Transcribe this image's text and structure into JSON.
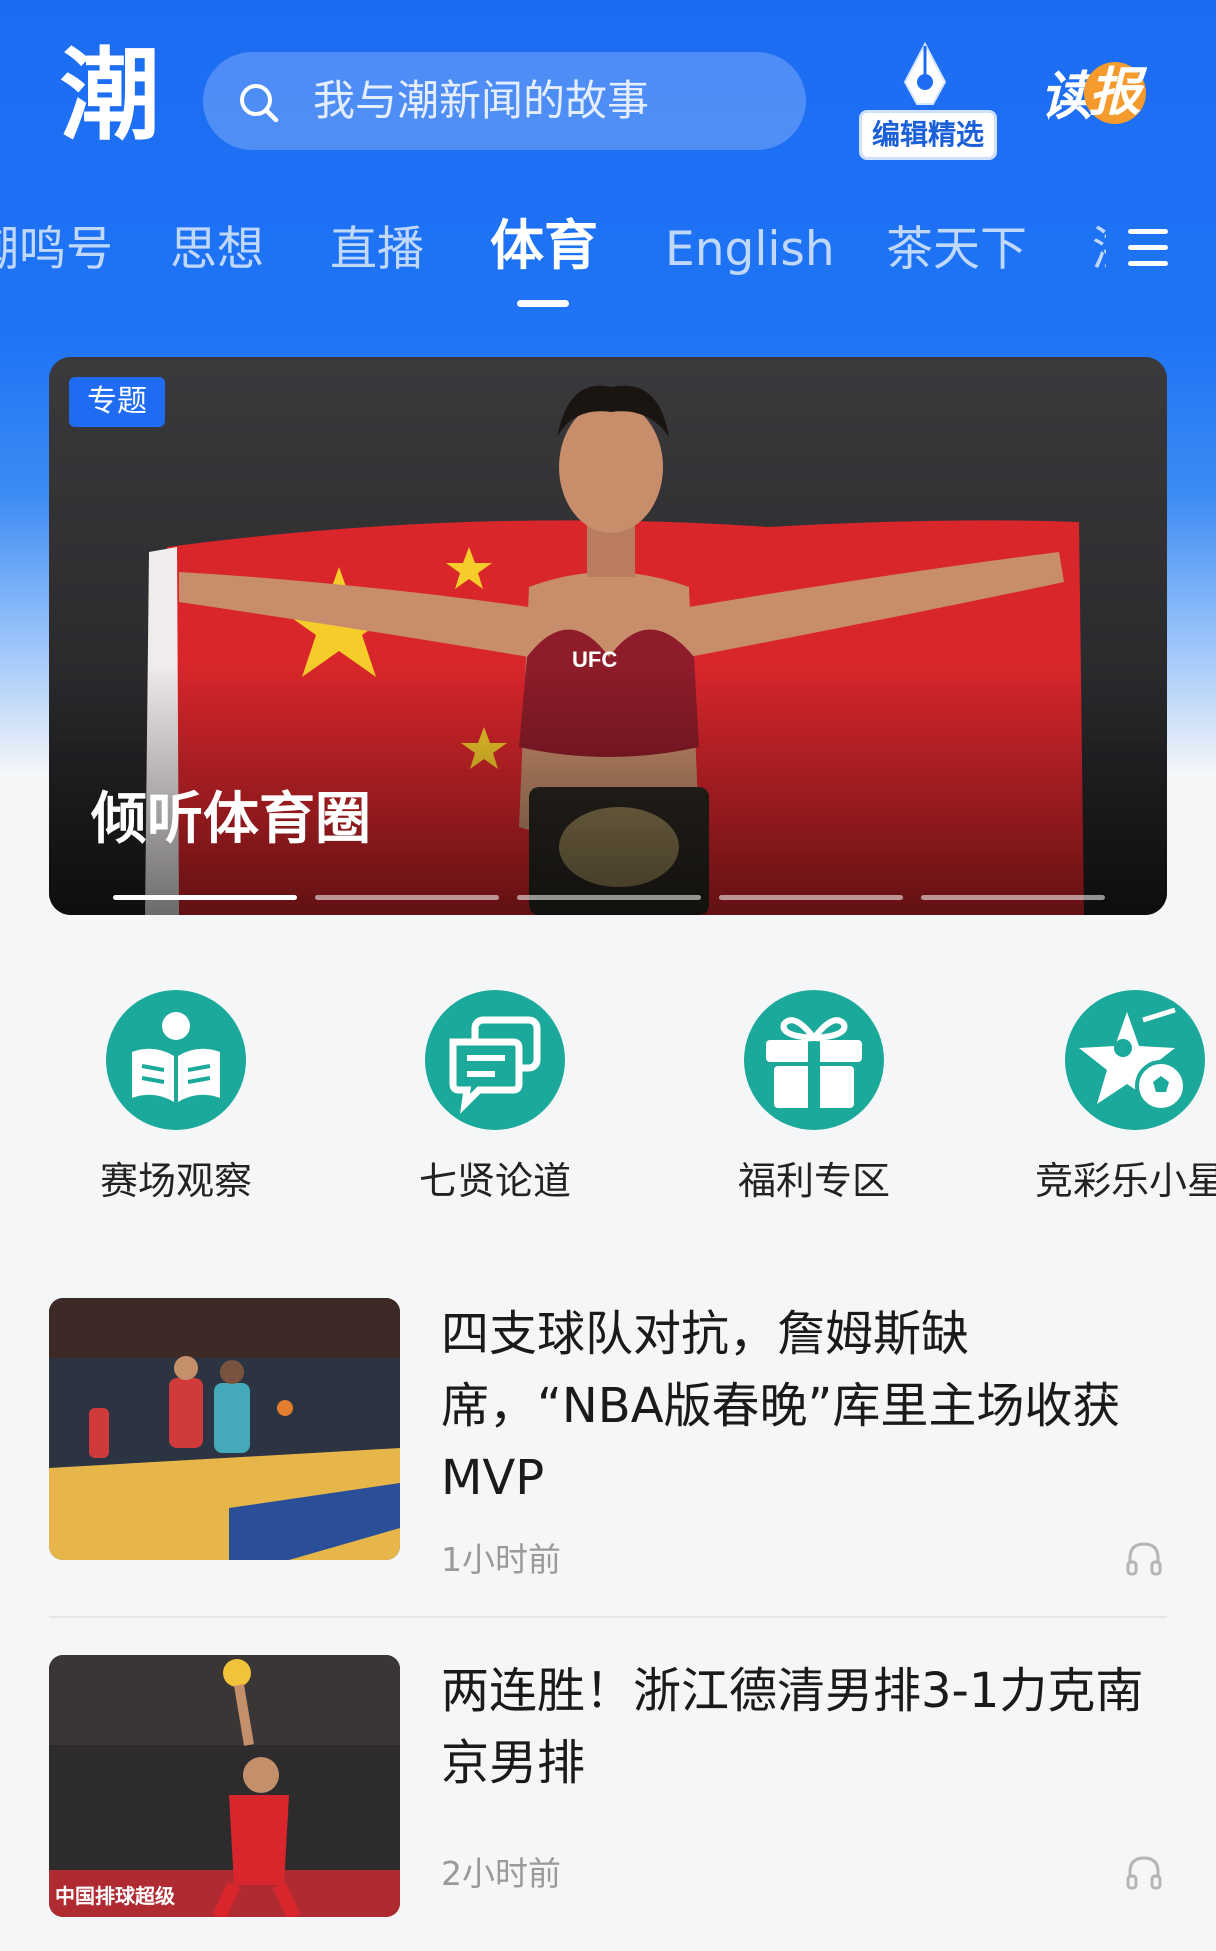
{
  "header": {
    "logo": "潮",
    "search_placeholder": "我与潮新闻的故事",
    "editor_pick_label": "编辑精选",
    "read_paper_label": "读",
    "read_paper_badge": "报"
  },
  "tabs": [
    {
      "label": "潮鸣号",
      "active": false
    },
    {
      "label": "思想",
      "active": false
    },
    {
      "label": "直播",
      "active": false
    },
    {
      "label": "体育",
      "active": true
    },
    {
      "label": "English",
      "active": false
    },
    {
      "label": "茶天下",
      "active": false
    },
    {
      "label": "浙",
      "active": false
    }
  ],
  "banner": {
    "tag": "专题",
    "title": "倾听体育圈",
    "slide_count": 5,
    "active_slide": 1
  },
  "shortcuts": [
    {
      "label": "赛场观察",
      "icon": "book-reader-icon"
    },
    {
      "label": "七贤论道",
      "icon": "chat-bubbles-icon"
    },
    {
      "label": "福利专区",
      "icon": "gift-icon"
    },
    {
      "label": "竞彩乐小星",
      "icon": "sports-star-icon"
    }
  ],
  "news": [
    {
      "title": "四支球队对抗，詹姆斯缺席，“NBA版春晚”库里主场收获MVP",
      "time": "1小时前"
    },
    {
      "title": "两连胜！浙江德清男排3-1力克南京男排",
      "time": "2小时前"
    }
  ],
  "colors": {
    "brand_blue": "#1f6cf3",
    "shortcut_teal": "#1aa99a",
    "badge_orange": "#f59a2c"
  }
}
